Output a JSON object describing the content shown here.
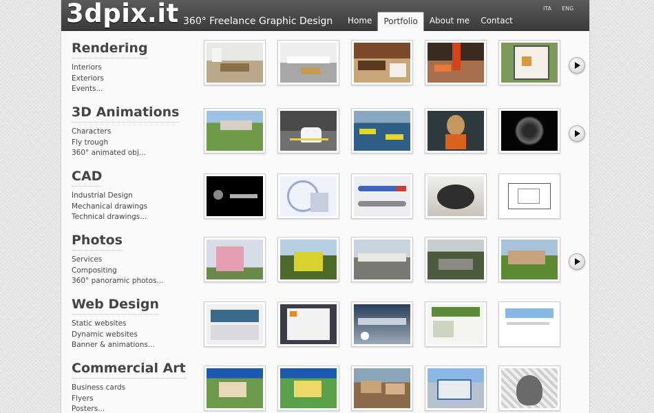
{
  "header": {
    "logo": "3dpix.it",
    "tagline": "360° Freelance Graphic Design",
    "nav": [
      "Home",
      "Portfolio",
      "About me",
      "Contact"
    ],
    "active_nav": "Portfolio",
    "languages": [
      "ITA",
      "ENG"
    ]
  },
  "sections": [
    {
      "title": "Rendering",
      "links": [
        "Interiors",
        "Exteriors",
        "Events..."
      ],
      "has_next": true
    },
    {
      "title": "3D Animations",
      "links": [
        "Characters",
        "Fly trough",
        "360° animated obj..."
      ],
      "has_next": true
    },
    {
      "title": "CAD",
      "links": [
        "Industrial Design",
        "Mechanical drawings",
        "Technical drawings..."
      ],
      "has_next": false
    },
    {
      "title": "Photos",
      "links": [
        "Services",
        "Compositing",
        "360° panoramic photos..."
      ],
      "has_next": true
    },
    {
      "title": "Web Design",
      "links": [
        "Static websites",
        "Dynamic websites",
        "Banner & animations..."
      ],
      "has_next": false
    },
    {
      "title": "Commercial Art",
      "links": [
        "Business cards",
        "Flyers",
        "Posters..."
      ],
      "has_next": false
    }
  ],
  "colors": {
    "header_bg": "#4a4a4a",
    "page_bg": "#fafafa",
    "text": "#444444"
  }
}
